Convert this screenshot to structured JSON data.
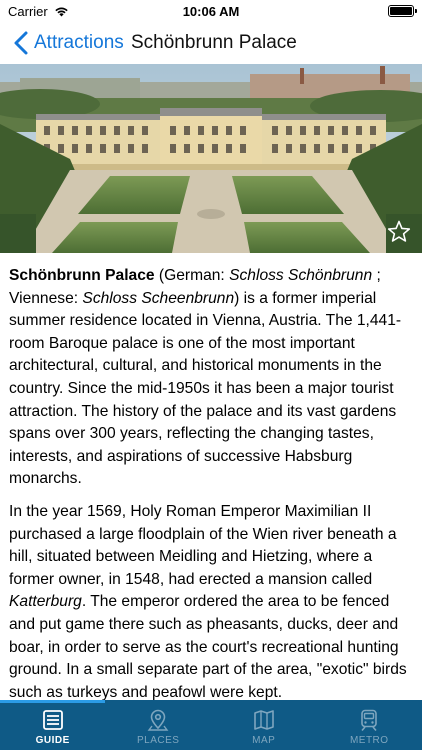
{
  "status_bar": {
    "carrier": "Carrier",
    "time": "10:06 AM"
  },
  "nav": {
    "back_label": "Attractions",
    "title": "Schönbrunn Palace"
  },
  "hero": {
    "icon": "star-outline-icon"
  },
  "article": {
    "p1": {
      "bold_name": "Schönbrunn Palace",
      "t1": " (German: ",
      "i1": "Schloss Schönbrunn",
      "t2": " ; Viennese: ",
      "i2": "Schloss Scheenbrunn",
      "t3": ") is a former imperial summer residence located in Vienna, Austria. The 1,441-room Baroque palace is one of the most important architectural, cultural, and historical monuments in the country. Since the mid-1950s it has been a major tourist attraction. The history of the palace and its vast gardens spans over 300 years, reflecting the changing tastes, interests, and aspirations of successive Habsburg monarchs."
    },
    "p2": {
      "t1": "In the year 1569, Holy Roman Emperor Maximilian II purchased a large floodplain of the Wien river beneath a hill, situated between Meidling and Hietzing, where a former owner, in 1548, had erected a mansion called ",
      "i1": "Katterburg",
      "t2": ". The emperor ordered the area to be fenced and put game there such as pheasants, ducks, deer and boar, in order to serve as the court's recreational hunting ground. In a small separate part of the area, \"exotic\" birds such as turkeys and peafowl were kept."
    }
  },
  "tabs": [
    {
      "label": "GUIDE",
      "icon": "guide-book-icon",
      "active": true
    },
    {
      "label": "PLACES",
      "icon": "map-pin-icon",
      "active": false
    },
    {
      "label": "MAP",
      "icon": "folded-map-icon",
      "active": false
    },
    {
      "label": "METRO",
      "icon": "metro-train-icon",
      "active": false
    }
  ],
  "colors": {
    "accent": "#1577d9",
    "tab_bar": "#0f5a86",
    "tab_selection": "#2b9be6"
  }
}
